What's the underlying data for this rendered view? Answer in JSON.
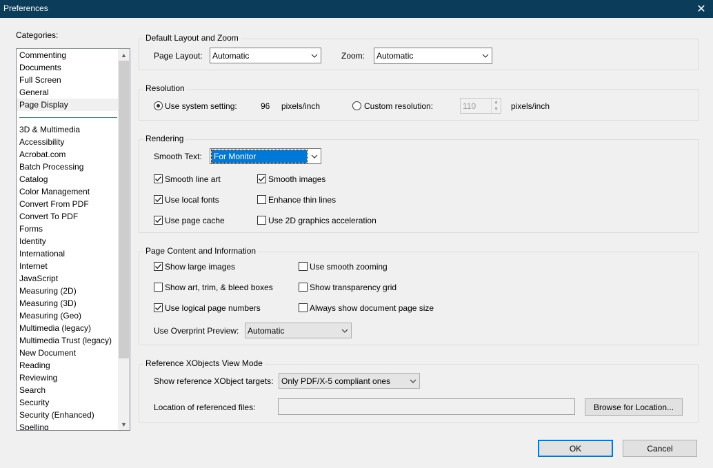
{
  "window": {
    "title": "Preferences"
  },
  "categories": {
    "label": "Categories:",
    "items_top": [
      "Commenting",
      "Documents",
      "Full Screen",
      "General",
      "Page Display"
    ],
    "items": [
      "3D & Multimedia",
      "Accessibility",
      "Acrobat.com",
      "Batch Processing",
      "Catalog",
      "Color Management",
      "Convert From PDF",
      "Convert To PDF",
      "Forms",
      "Identity",
      "International",
      "Internet",
      "JavaScript",
      "Measuring (2D)",
      "Measuring (3D)",
      "Measuring (Geo)",
      "Multimedia (legacy)",
      "Multimedia Trust (legacy)",
      "New Document",
      "Reading",
      "Reviewing",
      "Search",
      "Security",
      "Security (Enhanced)",
      "Spelling"
    ],
    "selected": "Page Display"
  },
  "layout_zoom": {
    "legend": "Default Layout and Zoom",
    "page_layout_label": "Page Layout:",
    "page_layout_value": "Automatic",
    "zoom_label": "Zoom:",
    "zoom_value": "Automatic"
  },
  "resolution": {
    "legend": "Resolution",
    "system_label": "Use system setting:",
    "system_value": "96",
    "system_unit": "pixels/inch",
    "custom_label": "Custom resolution:",
    "custom_value": "110",
    "custom_unit": "pixels/inch",
    "selected": "system"
  },
  "rendering": {
    "legend": "Rendering",
    "smooth_text_label": "Smooth Text:",
    "smooth_text_value": "For Monitor",
    "checks": [
      {
        "label": "Smooth line art",
        "checked": true
      },
      {
        "label": "Smooth images",
        "checked": true
      },
      {
        "label": "Use local fonts",
        "checked": true
      },
      {
        "label": "Enhance thin lines",
        "checked": false
      },
      {
        "label": "Use page cache",
        "checked": true
      },
      {
        "label": "Use 2D graphics acceleration",
        "checked": false
      }
    ]
  },
  "page_content": {
    "legend": "Page Content and Information",
    "checks": [
      {
        "label": "Show large images",
        "checked": true
      },
      {
        "label": "Use smooth zooming",
        "checked": false
      },
      {
        "label": "Show art, trim, & bleed boxes",
        "checked": false
      },
      {
        "label": "Show transparency grid",
        "checked": false
      },
      {
        "label": "Use logical page numbers",
        "checked": true
      },
      {
        "label": "Always show document page size",
        "checked": false
      }
    ],
    "overprint_label": "Use Overprint Preview:",
    "overprint_value": "Automatic"
  },
  "xobjects": {
    "legend": "Reference XObjects View Mode",
    "targets_label": "Show reference XObject targets:",
    "targets_value": "Only PDF/X-5 compliant ones",
    "location_label": "Location of referenced files:",
    "location_value": "",
    "browse_label": "Browse for Location..."
  },
  "buttons": {
    "ok": "OK",
    "cancel": "Cancel"
  },
  "icons": {
    "close": "close-icon",
    "chevron": "chevron-down-icon",
    "check": "checkmark-icon"
  }
}
